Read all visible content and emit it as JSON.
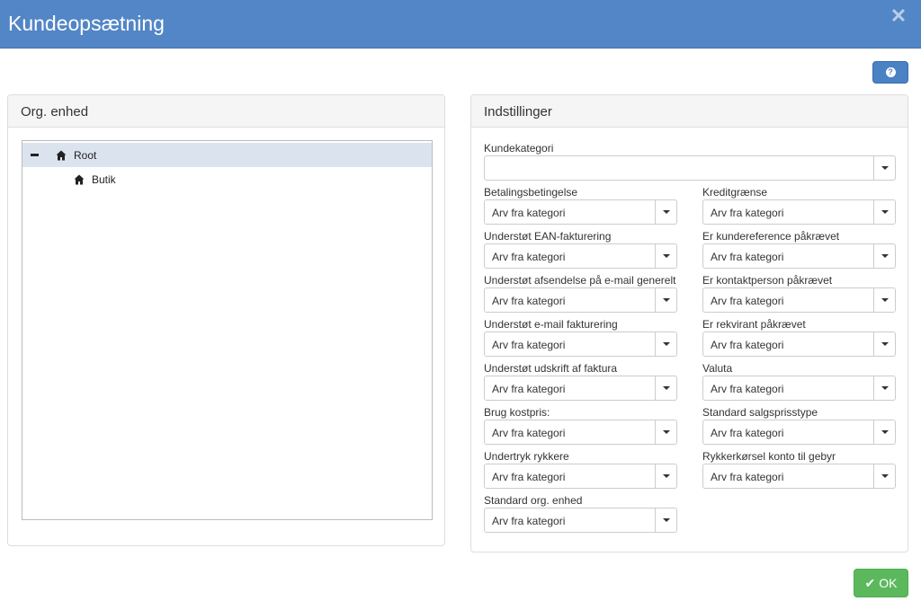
{
  "window": {
    "title": "Kundeopsætning",
    "close_icon": "close-icon"
  },
  "toolbar": {
    "help_icon_glyph": "?"
  },
  "org_panel": {
    "heading": "Org. enhed",
    "tree": [
      {
        "label": "Root",
        "icon": "home-icon",
        "selected": true,
        "expander": "collapse"
      },
      {
        "label": "Butik",
        "icon": "home-icon",
        "selected": false
      }
    ]
  },
  "settings_panel": {
    "heading": "Indstillinger",
    "kundekategori": {
      "label": "Kundekategori",
      "value": ""
    },
    "left": [
      {
        "label": "Betalingsbetingelse",
        "value": "Arv fra kategori"
      },
      {
        "label": "Understøt EAN-fakturering",
        "value": "Arv fra kategori"
      },
      {
        "label": "Understøt afsendelse på e-mail generelt",
        "value": "Arv fra kategori"
      },
      {
        "label": "Understøt e-mail fakturering",
        "value": "Arv fra kategori"
      },
      {
        "label": "Understøt udskrift af faktura",
        "value": "Arv fra kategori"
      },
      {
        "label": "Brug kostpris:",
        "value": "Arv fra kategori"
      },
      {
        "label": "Undertryk rykkere",
        "value": "Arv fra kategori"
      },
      {
        "label": "Standard org. enhed",
        "value": "Arv fra kategori"
      }
    ],
    "right": [
      {
        "label": "Kreditgrænse",
        "value": "Arv fra kategori"
      },
      {
        "label": "Er kundereference påkrævet",
        "value": "Arv fra kategori"
      },
      {
        "label": "Er kontaktperson påkrævet",
        "value": "Arv fra kategori"
      },
      {
        "label": "Er rekvirant påkrævet",
        "value": "Arv fra kategori"
      },
      {
        "label": "Valuta",
        "value": "Arv fra kategori"
      },
      {
        "label": "Standard salgsprisstype",
        "value": "Arv fra kategori"
      },
      {
        "label": "Rykkerkørsel konto til gebyr",
        "value": "Arv fra kategori"
      }
    ]
  },
  "footer": {
    "ok_label": "OK",
    "ok_icon": "check-icon"
  },
  "colors": {
    "header": "#5286c6",
    "primary": "#4a82c4",
    "success": "#5cb85c",
    "selected_row": "#dbe4ee"
  }
}
